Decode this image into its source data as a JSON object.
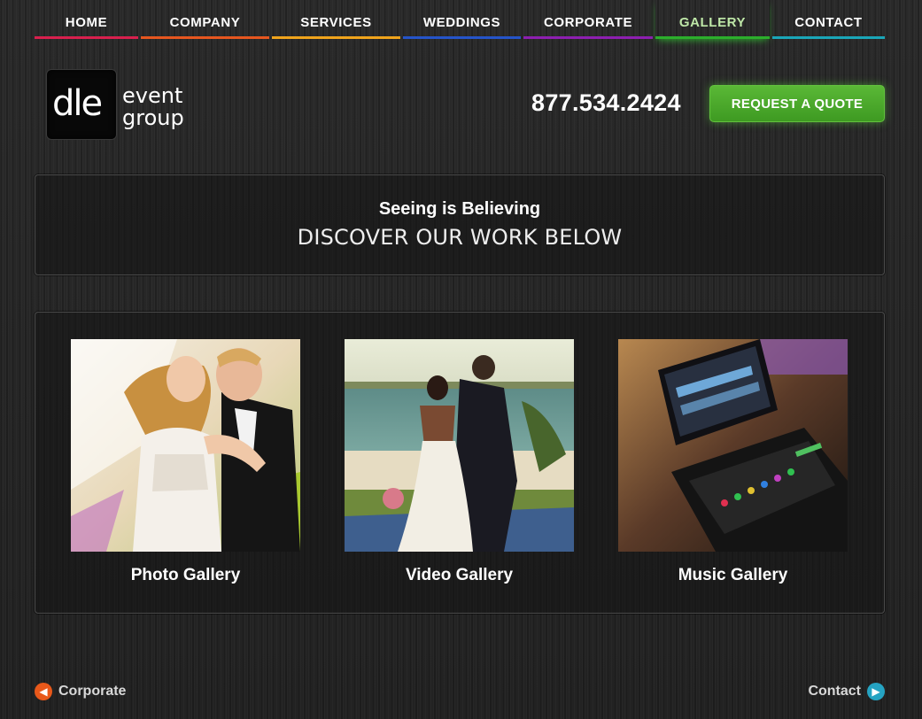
{
  "nav": {
    "items": [
      {
        "label": "HOME",
        "color": "#d8204e"
      },
      {
        "label": "COMPANY",
        "color": "#e6561f"
      },
      {
        "label": "SERVICES",
        "color": "#f0a41c"
      },
      {
        "label": "WEDDINGS",
        "color": "#2554c9"
      },
      {
        "label": "CORPORATE",
        "color": "#8d1fb0"
      },
      {
        "label": "GALLERY",
        "color": "#2cae2c"
      },
      {
        "label": "CONTACT",
        "color": "#1aa6b8"
      }
    ],
    "active_index": 5
  },
  "header": {
    "logo_mark": "dle",
    "logo_word_1": "event",
    "logo_word_2": "group",
    "phone": "877.534.2424",
    "quote_label": "REQUEST A QUOTE"
  },
  "intro": {
    "subtitle": "Seeing is Believing",
    "title": "DISCOVER OUR WORK BELOW"
  },
  "galleries": [
    {
      "label": "Photo Gallery"
    },
    {
      "label": "Video Gallery"
    },
    {
      "label": "Music Gallery"
    }
  ],
  "pager": {
    "prev_label": "Corporate",
    "next_label": "Contact"
  },
  "colors": {
    "accent_green": "#4caf2e",
    "prev_icon": "#e8581a",
    "next_icon": "#25a3c2"
  }
}
